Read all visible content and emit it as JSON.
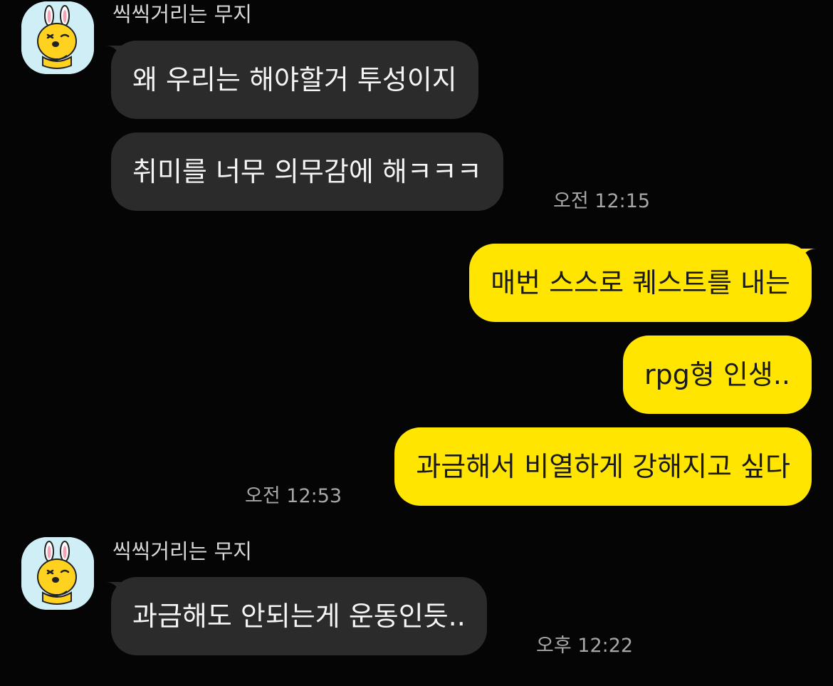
{
  "colors": {
    "background": "#050505",
    "incoming_bubble": "#2b2b2b",
    "outgoing_bubble": "#ffe500",
    "avatar_bg": "#cfeef5"
  },
  "groups": [
    {
      "sender": "씩씩거리는 무지",
      "avatar_icon": "muzi-character-icon",
      "messages": [
        "왜 우리는 해야할거 투성이지",
        "취미를 너무 의무감에 해ㅋㅋㅋ"
      ],
      "time": "오전 12:15"
    },
    {
      "messages": [
        "매번 스스로 퀘스트를 내는",
        "rpg형 인생..",
        "과금해서 비열하게 강해지고 싶다"
      ],
      "time": "오전 12:53"
    },
    {
      "sender": "씩씩거리는 무지",
      "avatar_icon": "muzi-character-icon",
      "messages": [
        "과금해도 안되는게 운동인듯.."
      ],
      "time": "오후 12:22"
    }
  ]
}
